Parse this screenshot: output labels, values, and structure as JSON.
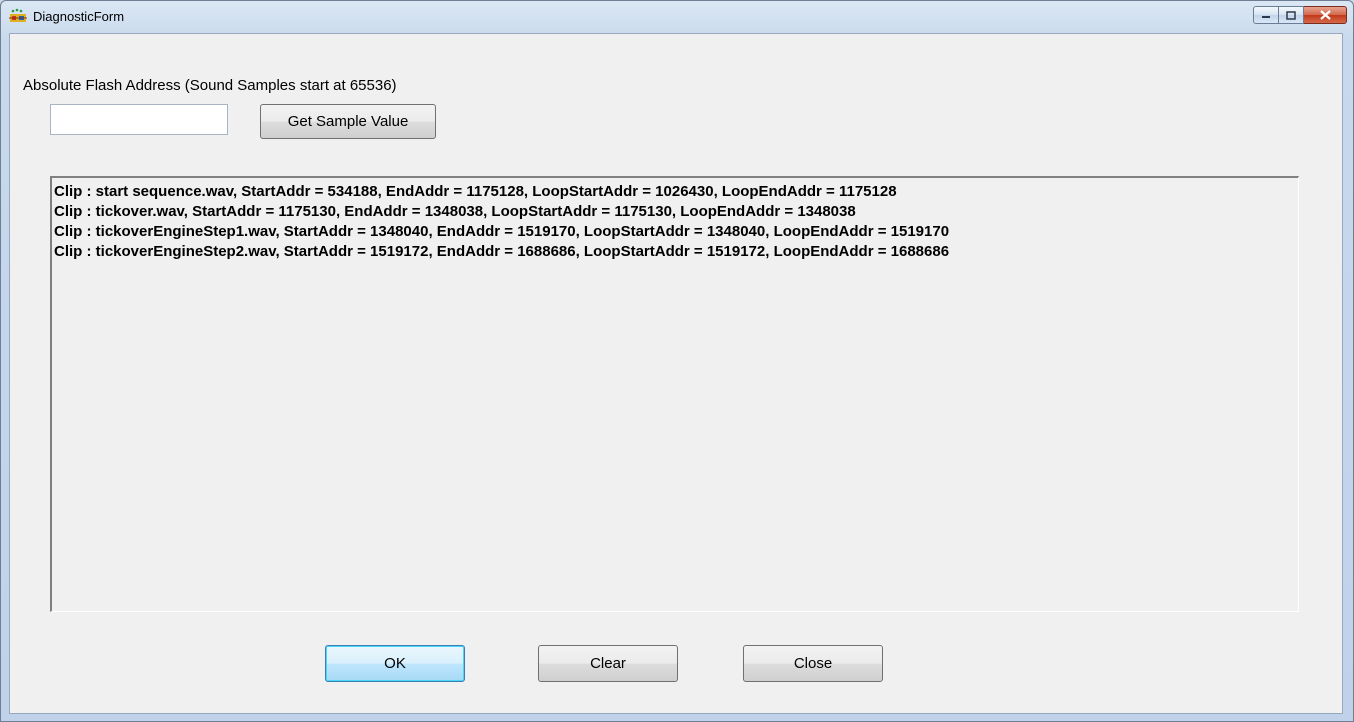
{
  "window": {
    "title": "DiagnosticForm",
    "icon": "app-icon"
  },
  "form": {
    "address_label": "Absolute Flash Address (Sound Samples start at 65536)",
    "address_value": "",
    "get_sample_label": "Get Sample Value"
  },
  "log": {
    "lines": [
      "Clip : start sequence.wav, StartAddr = 534188, EndAddr = 1175128, LoopStartAddr = 1026430, LoopEndAddr = 1175128",
      "Clip : tickover.wav, StartAddr = 1175130, EndAddr = 1348038, LoopStartAddr = 1175130, LoopEndAddr = 1348038",
      "Clip : tickoverEngineStep1.wav, StartAddr = 1348040, EndAddr = 1519170, LoopStartAddr = 1348040, LoopEndAddr = 1519170",
      "Clip : tickoverEngineStep2.wav, StartAddr = 1519172, EndAddr = 1688686, LoopStartAddr = 1519172, LoopEndAddr = 1688686"
    ]
  },
  "buttons": {
    "ok": "OK",
    "clear": "Clear",
    "close": "Close"
  }
}
